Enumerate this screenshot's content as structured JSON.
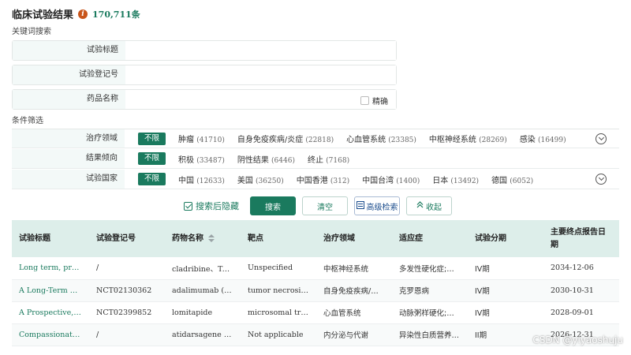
{
  "header": {
    "title": "临床试验结果",
    "info_icon": "i",
    "count": "170,711条"
  },
  "keyword_section": {
    "title": "关键词搜索",
    "fields": [
      {
        "label": "试验标题",
        "value": ""
      },
      {
        "label": "试验登记号",
        "value": ""
      },
      {
        "label": "药品名称",
        "value": ""
      }
    ],
    "exact_label": "精确"
  },
  "filter_section": {
    "title": "条件筛选",
    "rows": [
      {
        "label": "治疗领域",
        "unlimited": "不限",
        "options": [
          {
            "name": "肿瘤",
            "count": "(41710)"
          },
          {
            "name": "自身免疫疾病/炎症",
            "count": "(22818)"
          },
          {
            "name": "心血管系统",
            "count": "(23385)"
          },
          {
            "name": "中枢神经系统",
            "count": "(28269)"
          },
          {
            "name": "感染",
            "count": "(16499)"
          }
        ]
      },
      {
        "label": "结果倾向",
        "unlimited": "不限",
        "options": [
          {
            "name": "积极",
            "count": "(33487)"
          },
          {
            "name": "阴性结果",
            "count": "(6446)"
          },
          {
            "name": "终止",
            "count": "(7168)"
          }
        ]
      },
      {
        "label": "试验国家",
        "unlimited": "不限",
        "options": [
          {
            "name": "中国",
            "count": "(12633)"
          },
          {
            "name": "美国",
            "count": "(36250)"
          },
          {
            "name": "中国香港",
            "count": "(312)"
          },
          {
            "name": "中国台湾",
            "count": "(1400)"
          },
          {
            "name": "日本",
            "count": "(13492)"
          },
          {
            "name": "德国",
            "count": "(6052)"
          }
        ]
      }
    ]
  },
  "actions": {
    "hide_after_search": "搜索后隐藏",
    "search": "搜索",
    "clear": "清空",
    "advanced": "高级检索",
    "collapse": "收起"
  },
  "table": {
    "columns": [
      "试验标题",
      "试验登记号",
      "药物名称",
      "靶点",
      "治疗领域",
      "适应症",
      "试验分期",
      "主要终点报告日期"
    ],
    "rows": [
      [
        "Long term, prosp…",
        "/",
        "cladribine、Teva",
        "Unspecified",
        "中枢神经系统",
        "多发性硬化症;…",
        "IV期",
        "2034-12-06"
      ],
      [
        "A Long-Term No…",
        "NCT02130362",
        "adalimumab (SC)",
        "tumor necrosis fa…",
        "自身免疫疾病/…",
        "克罗恩病",
        "IV期",
        "2030-10-31"
      ],
      [
        "A Prospective, Ob…",
        "NCT02399852",
        "lomitapide",
        "microsomal trigl…",
        "心血管系统",
        "动脉粥样硬化;…",
        "IV期",
        "2028-09-01"
      ],
      [
        "Compassionate us…",
        "/",
        "atidarsagene auto…",
        "Not applicable",
        "内分泌与代谢",
        "异染性白质营养…",
        "II期",
        "2026-12-31"
      ]
    ]
  },
  "watermark": "CSDN @yiyaoshuju"
}
